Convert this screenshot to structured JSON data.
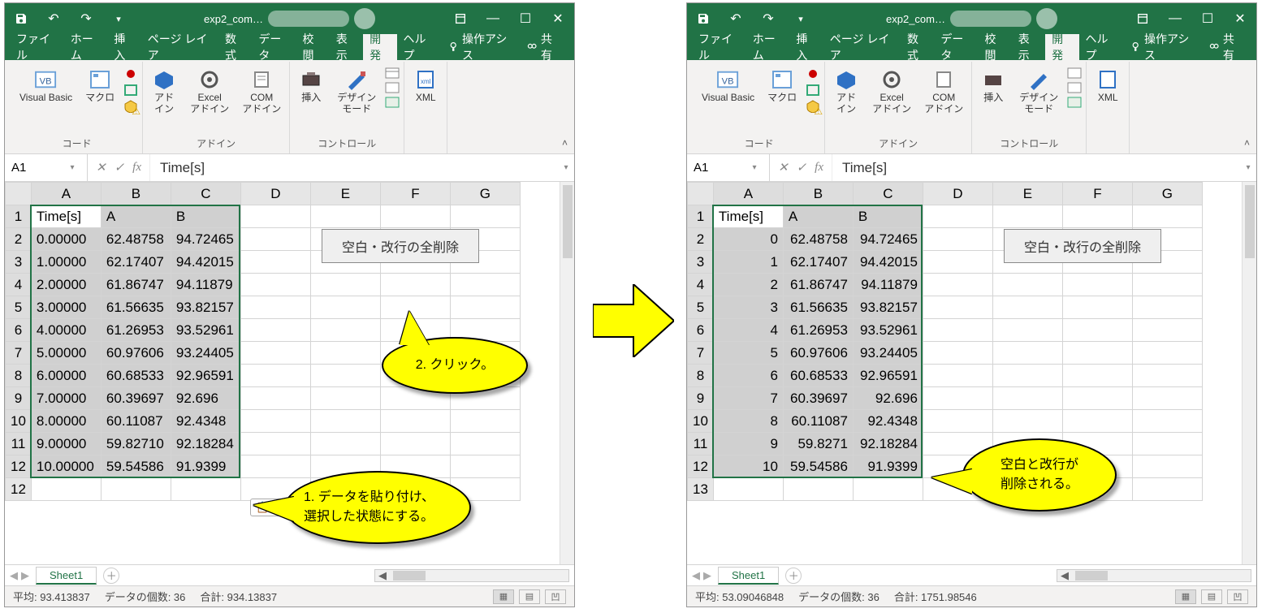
{
  "title": "exp2_com…",
  "tabs": {
    "file": "ファイル",
    "home": "ホーム",
    "insert": "挿入",
    "pageLayout": "ページ レイア",
    "formulas": "数式",
    "data": "データ",
    "review": "校閲",
    "view": "表示",
    "developer": "開発",
    "help": "ヘルプ",
    "tellme": "操作アシス",
    "share": "共有"
  },
  "ribbon": {
    "code": {
      "label": "コード",
      "vb": "Visual Basic",
      "macro": "マクロ"
    },
    "addins": {
      "label": "アドイン",
      "addin": "アド\nイン",
      "excel": "Excel\nアドイン",
      "com": "COM\nアドイン"
    },
    "controls": {
      "label": "コントロール",
      "insert": "挿入",
      "design": "デザイン\nモード"
    },
    "xml": {
      "label": "",
      "xml": "XML"
    }
  },
  "nameBox": "A1",
  "formula": "Time[s]",
  "columns": [
    "A",
    "B",
    "C",
    "D",
    "E",
    "F",
    "G"
  ],
  "macroButton": "空白・改行の全削除",
  "pasteTag": "(Ctrl)",
  "left": {
    "rows": [
      [
        "Time[s]",
        "A",
        "B"
      ],
      [
        "0.00000",
        "62.48758",
        "94.72465"
      ],
      [
        "1.00000",
        "62.17407",
        "94.42015"
      ],
      [
        "2.00000",
        "61.86747",
        "94.11879"
      ],
      [
        "3.00000",
        "61.56635",
        "93.82157"
      ],
      [
        "4.00000",
        "61.26953",
        "93.52961"
      ],
      [
        "5.00000",
        "60.97606",
        "93.24405"
      ],
      [
        "6.00000",
        "60.68533",
        "92.96591"
      ],
      [
        "7.00000",
        "60.39697",
        "92.696"
      ],
      [
        "8.00000",
        "60.11087",
        "92.4348"
      ],
      [
        "9.00000",
        "59.82710",
        "92.18284"
      ],
      [
        "10.00000",
        "59.54586",
        "91.9399"
      ]
    ],
    "status": {
      "avg": "平均: 93.413837",
      "count": "データの個数: 36",
      "sum": "合計: 934.13837"
    }
  },
  "right": {
    "rows": [
      [
        "Time[s]",
        "A",
        "B"
      ],
      [
        "0",
        "62.48758",
        "94.72465"
      ],
      [
        "1",
        "62.17407",
        "94.42015"
      ],
      [
        "2",
        "61.86747",
        "94.11879"
      ],
      [
        "3",
        "61.56635",
        "93.82157"
      ],
      [
        "4",
        "61.26953",
        "93.52961"
      ],
      [
        "5",
        "60.97606",
        "93.24405"
      ],
      [
        "6",
        "60.68533",
        "92.96591"
      ],
      [
        "7",
        "60.39697",
        "92.696"
      ],
      [
        "8",
        "60.11087",
        "92.4348"
      ],
      [
        "9",
        "59.8271",
        "92.18284"
      ],
      [
        "10",
        "59.54586",
        "91.9399"
      ]
    ],
    "status": {
      "avg": "平均: 53.09046848",
      "count": "データの個数: 36",
      "sum": "合計: 1751.98546"
    }
  },
  "sheetTab": "Sheet1",
  "callouts": {
    "c1": "1. データを貼り付け、\n選択した状態にする。",
    "c2": "2. クリック。",
    "c3": "空白と改行が\n削除される。"
  }
}
